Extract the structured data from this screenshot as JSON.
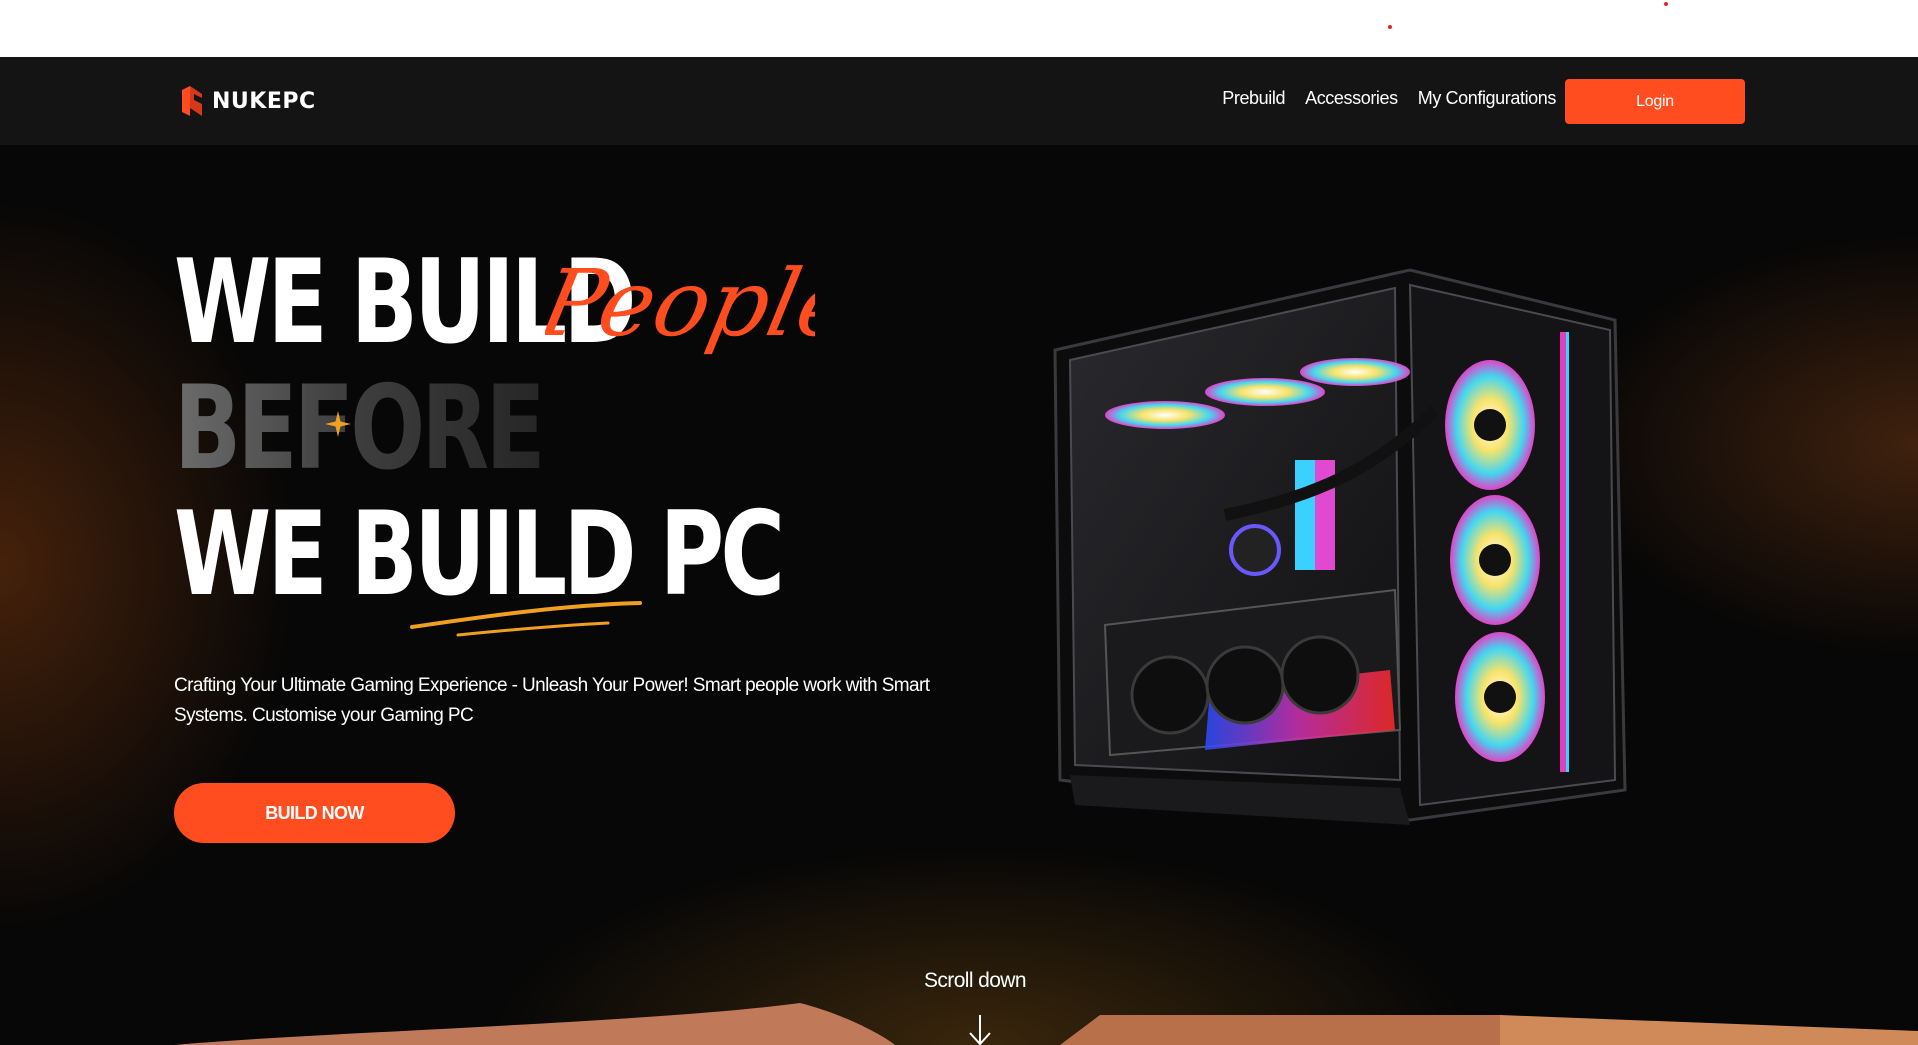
{
  "brand": {
    "name": "NUKEPC",
    "logo_icon": "nukepc-logo-icon",
    "accent": "#ff4d1f"
  },
  "nav": {
    "links": [
      "Prebuild",
      "Accessories",
      "My Configurations"
    ],
    "login_label": "Login"
  },
  "hero": {
    "line1": "WE BUILD",
    "script_word": "People",
    "line2": "BEFORE",
    "line3": "WE BUILD PC",
    "subtext": "Crafting Your Ultimate Gaming Experience - Unleash Your Power! Smart people work with Smart Systems. Customise your Gaming PC",
    "cta_label": "BUILD NOW",
    "image": "gaming-pc-case-image"
  },
  "scroll": {
    "label": "Scroll down",
    "icon": "arrow-down-icon"
  }
}
